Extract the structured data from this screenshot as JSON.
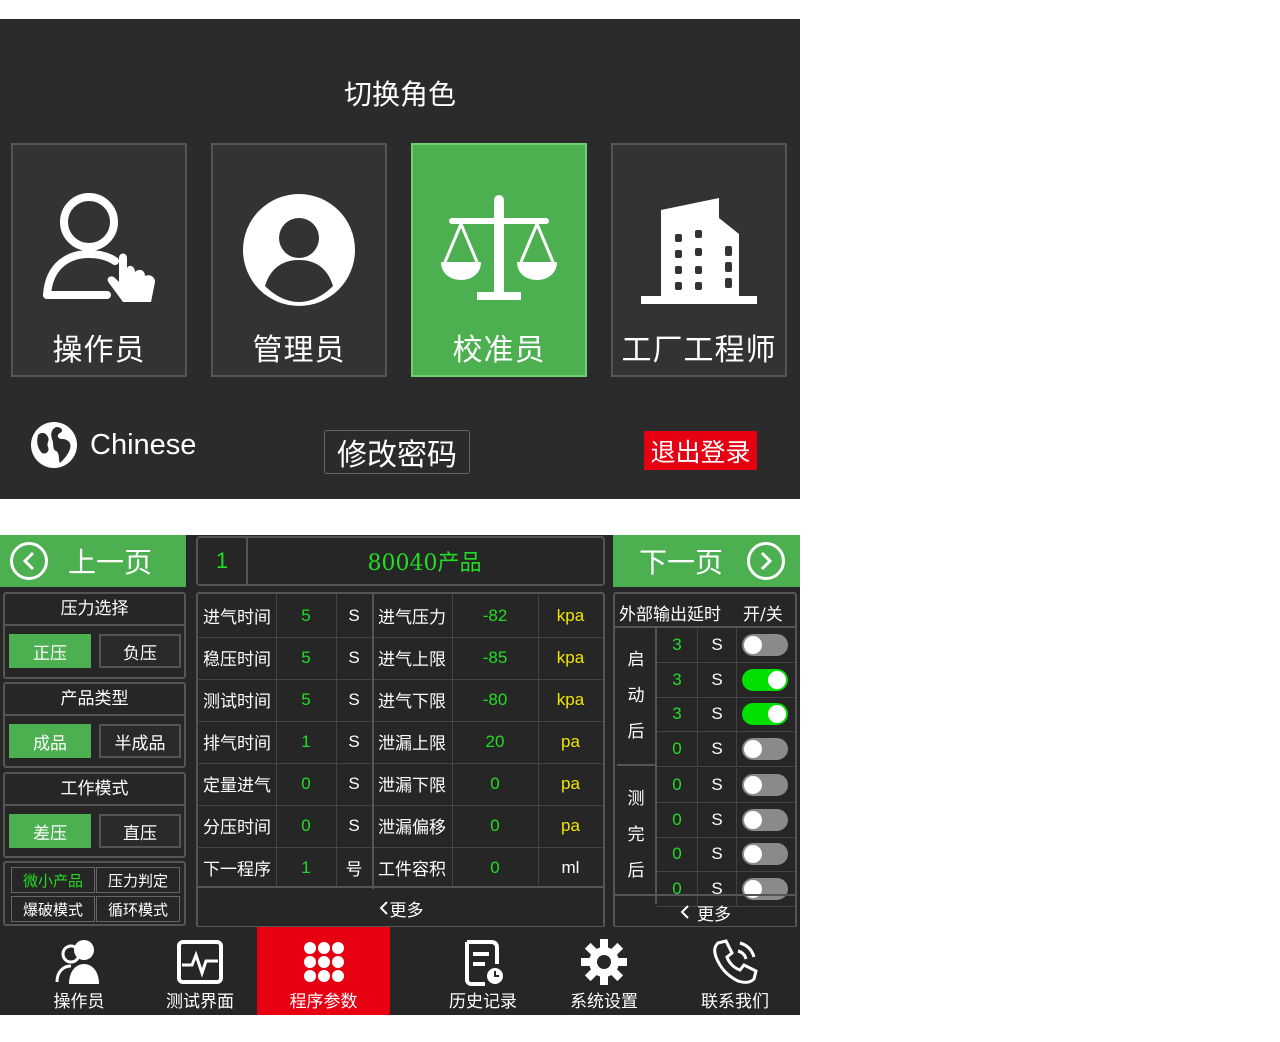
{
  "role_panel": {
    "title": "切换角色",
    "roles": [
      {
        "label": "操作员",
        "icon": "user-hand-icon",
        "active": false
      },
      {
        "label": "管理员",
        "icon": "user-circle-icon",
        "active": false
      },
      {
        "label": "校准员",
        "icon": "scale-icon",
        "active": true
      },
      {
        "label": "工厂工程师",
        "icon": "building-icon",
        "active": false
      }
    ],
    "language": "Chinese",
    "change_password": "修改密码",
    "logout": "退出登录"
  },
  "program_panel": {
    "prev_label": "上一页",
    "next_label": "下一页",
    "program_number": "1",
    "program_name": "80040产品",
    "pressure": {
      "title": "压力选择",
      "options": [
        "正压",
        "负压"
      ],
      "selected": 0
    },
    "product": {
      "title": "产品类型",
      "options": [
        "成品",
        "半成品"
      ],
      "selected": 0
    },
    "work": {
      "title": "工作模式",
      "options": [
        "差压",
        "直压"
      ],
      "selected": 0
    },
    "modes": [
      "微小产品",
      "压力判定",
      "爆破模式",
      "循环模式"
    ],
    "params_left": [
      {
        "label": "进气时间",
        "value": "5",
        "unit": "S"
      },
      {
        "label": "稳压时间",
        "value": "5",
        "unit": "S"
      },
      {
        "label": "测试时间",
        "value": "5",
        "unit": "S"
      },
      {
        "label": "排气时间",
        "value": "1",
        "unit": "S"
      },
      {
        "label": "定量进气",
        "value": "0",
        "unit": "S"
      },
      {
        "label": "分压时间",
        "value": "0",
        "unit": "S"
      },
      {
        "label": "下一程序",
        "value": "1",
        "unit": "号"
      }
    ],
    "params_right": [
      {
        "label": "进气压力",
        "value": "-82",
        "unit": "kpa"
      },
      {
        "label": "进气上限",
        "value": "-85",
        "unit": "kpa"
      },
      {
        "label": "进气下限",
        "value": "-80",
        "unit": "kpa"
      },
      {
        "label": "泄漏上限",
        "value": "20",
        "unit": "pa"
      },
      {
        "label": "泄漏下限",
        "value": "0",
        "unit": "pa"
      },
      {
        "label": "泄漏偏移",
        "value": "0",
        "unit": "pa"
      },
      {
        "label": "工件容积",
        "value": "0",
        "unit": "ml"
      }
    ],
    "more_label": "更多",
    "output": {
      "title": "外部输出延时",
      "toggle_header": "开/关",
      "group1_label": "启动后",
      "group2_label": "测完后",
      "rows": [
        {
          "value": "3",
          "unit": "S",
          "on": false
        },
        {
          "value": "3",
          "unit": "S",
          "on": true
        },
        {
          "value": "3",
          "unit": "S",
          "on": true
        },
        {
          "value": "0",
          "unit": "S",
          "on": false
        },
        {
          "value": "0",
          "unit": "S",
          "on": false
        },
        {
          "value": "0",
          "unit": "S",
          "on": false
        },
        {
          "value": "0",
          "unit": "S",
          "on": false
        },
        {
          "value": "0",
          "unit": "S",
          "on": false
        }
      ],
      "more_label": "更多"
    },
    "bottom_nav": [
      {
        "label": "操作员",
        "icon": "users-icon",
        "active": false
      },
      {
        "label": "测试界面",
        "icon": "monitor-icon",
        "active": false
      },
      {
        "label": "程序参数",
        "icon": "grid-icon",
        "active": true
      },
      {
        "label": "历史记录",
        "icon": "document-icon",
        "active": false
      },
      {
        "label": "系统设置",
        "icon": "gear-icon",
        "active": false
      },
      {
        "label": "联系我们",
        "icon": "phone-icon",
        "active": false
      }
    ]
  }
}
